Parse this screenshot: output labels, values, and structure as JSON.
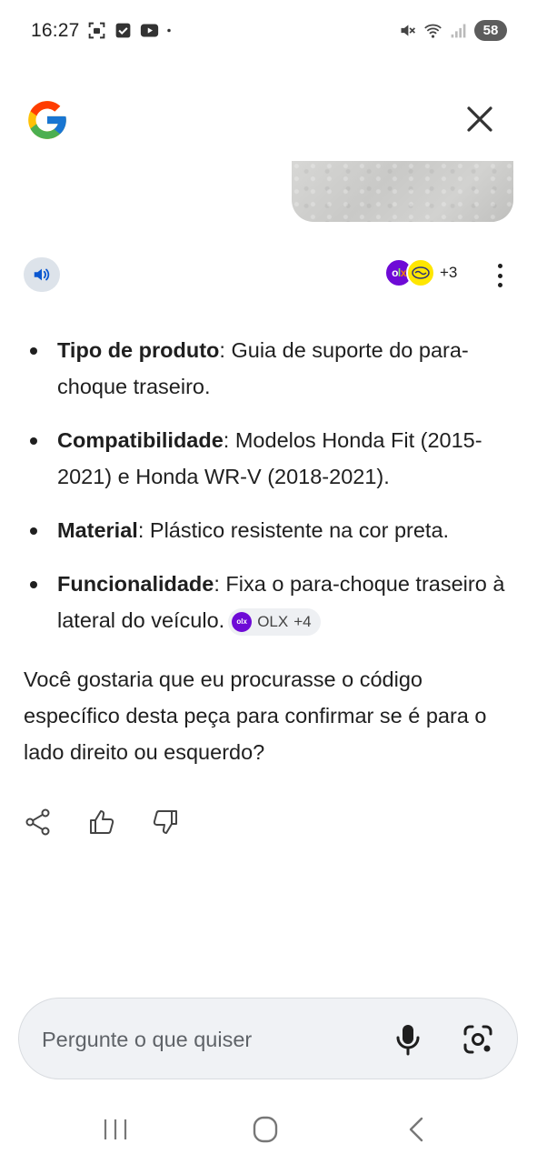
{
  "status_bar": {
    "time": "16:27",
    "battery": "58",
    "icons_left": [
      "screenshot-icon",
      "check-box-icon",
      "youtube-icon",
      "dot-icon"
    ],
    "icons_right": [
      "mute-icon",
      "wifi-icon",
      "signal-icon"
    ]
  },
  "header": {
    "logo": "google-g-logo",
    "close_icon": "close-icon"
  },
  "response": {
    "audio_icon": "speaker-icon",
    "sources": {
      "avatars": [
        "OLX",
        "mercado-livre-handshake"
      ],
      "extra_count": "+3"
    },
    "bullets": [
      {
        "term": "Tipo de produto",
        "sep": ": ",
        "text": "Guia de suporte do para-choque traseiro."
      },
      {
        "term": "Compatibilidade",
        "sep": ": ",
        "text": "Modelos Honda Fit (2015-2021) e Honda WR-V (2018-2021)."
      },
      {
        "term": "Material",
        "sep": ": ",
        "text": "Plástico resistente na cor preta."
      },
      {
        "term": "Funcionalidade",
        "sep": ": ",
        "text": "Fixa o para-choque traseiro à lateral do veículo.",
        "chip": {
          "label": "OLX",
          "extra": "+4"
        }
      }
    ],
    "followup": "Você gostaria que eu procurasse o código específico desta peça para confirmar se é para o lado direito ou esquerdo?",
    "feedback_icons": [
      "share-icon",
      "thumbs-up-icon",
      "thumbs-down-icon"
    ]
  },
  "input": {
    "placeholder": "Pergunte o que quiser",
    "value": ""
  },
  "nav_bar": [
    "recent-apps-icon",
    "home-icon",
    "back-icon"
  ],
  "colors": {
    "google_blue": "#4285F4",
    "google_red": "#EA4335",
    "google_yellow": "#FBBC05",
    "google_green": "#34A853",
    "olx_purple": "#6e0ad6",
    "audio_button_bg": "#dde3ea",
    "speaker_blue": "#0b57d0"
  }
}
